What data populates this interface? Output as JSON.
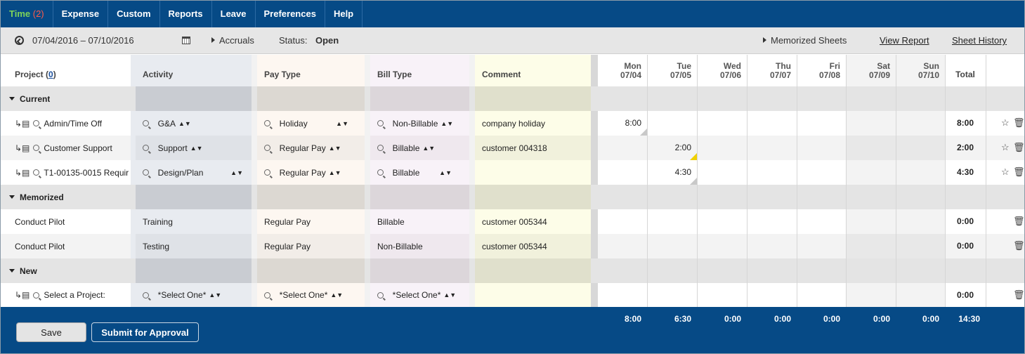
{
  "nav": {
    "tabs": [
      {
        "label": "Time",
        "count": "(2)"
      },
      {
        "label": "Expense"
      },
      {
        "label": "Custom"
      },
      {
        "label": "Reports"
      },
      {
        "label": "Leave"
      },
      {
        "label": "Preferences"
      },
      {
        "label": "Help"
      }
    ]
  },
  "toolbar": {
    "date_range": "07/04/2016 – 07/10/2016",
    "accruals": "Accruals",
    "status_label": "Status:",
    "status_value": "Open",
    "memorized_sheets": "Memorized Sheets",
    "view_report": "View Report",
    "sheet_history": "Sheet History"
  },
  "columns": {
    "project": "Project",
    "project_count": "0",
    "activity": "Activity",
    "pay_type": "Pay Type",
    "bill_type": "Bill Type",
    "comment": "Comment",
    "days": [
      {
        "name": "Mon",
        "date": "07/04"
      },
      {
        "name": "Tue",
        "date": "07/05"
      },
      {
        "name": "Wed",
        "date": "07/06"
      },
      {
        "name": "Thu",
        "date": "07/07"
      },
      {
        "name": "Fri",
        "date": "07/08"
      },
      {
        "name": "Sat",
        "date": "07/09"
      },
      {
        "name": "Sun",
        "date": "07/10"
      }
    ],
    "total": "Total"
  },
  "sections": {
    "current": "Current",
    "memorized": "Memorized",
    "new": "New"
  },
  "rows": {
    "current": [
      {
        "project": "Admin/Time Off",
        "activity": "G&A",
        "pay_type": "Holiday",
        "bill_type": "Non-Billable",
        "comment": "company holiday",
        "hours": [
          "8:00",
          "",
          "",
          "",
          "",
          "",
          ""
        ],
        "total": "8:00"
      },
      {
        "project": "Customer Support",
        "activity": "Support",
        "pay_type": "Regular Pay",
        "bill_type": "Billable",
        "comment": "customer 004318",
        "hours": [
          "",
          "2:00",
          "",
          "",
          "",
          "",
          ""
        ],
        "total": "2:00"
      },
      {
        "project": "T1-00135-0015 Requir",
        "activity": "Design/Plan",
        "pay_type": "Regular Pay",
        "bill_type": "Billable",
        "comment": "",
        "hours": [
          "",
          "4:30",
          "",
          "",
          "",
          "",
          ""
        ],
        "total": "4:30"
      }
    ],
    "memorized": [
      {
        "project": "Conduct Pilot",
        "activity": "Training",
        "pay_type": "Regular Pay",
        "bill_type": "Billable",
        "comment": "customer 005344",
        "total": "0:00"
      },
      {
        "project": "Conduct Pilot",
        "activity": "Testing",
        "pay_type": "Regular Pay",
        "bill_type": "Non-Billable",
        "comment": "customer 005344",
        "total": "0:00"
      }
    ],
    "new": [
      {
        "project": "Select a Project:",
        "activity": "*Select One*",
        "pay_type": "*Select One*",
        "bill_type": "*Select One*",
        "comment": "",
        "total": "0:00"
      }
    ]
  },
  "footer": {
    "save": "Save",
    "submit": "Submit for Approval",
    "day_totals": [
      "8:00",
      "6:30",
      "0:00",
      "0:00",
      "0:00",
      "0:00",
      "0:00"
    ],
    "grand_total": "14:30"
  },
  "colors": {
    "nav_bg": "#064a86",
    "active_tab": "#7fd35a",
    "count": "#ff5a4a",
    "activity_col": "#e8ebf0",
    "paytype_col": "#fdf7f1",
    "billtype_col": "#f8f2f8",
    "comment_col": "#fdfde8"
  }
}
